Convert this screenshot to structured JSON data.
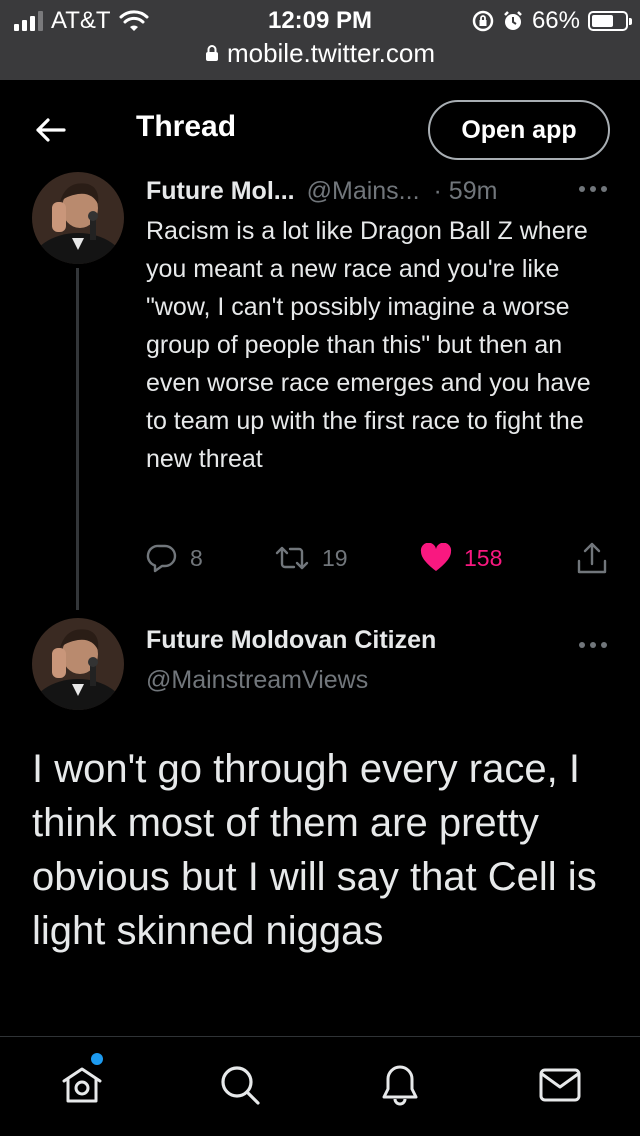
{
  "status_bar": {
    "carrier": "AT&T",
    "time": "12:09 PM",
    "battery_percent": "66%",
    "battery_level": 0.66,
    "signal_bars_on": 3,
    "url": "mobile.twitter.com",
    "bg_color": "#3a3a3c"
  },
  "header": {
    "title": "Thread",
    "open_app_label": "Open app",
    "back_icon": "back-arrow-icon"
  },
  "tweets": [
    {
      "display_name": "Future Mol...",
      "handle": "@Mains...",
      "time": "· 59m",
      "text": "Racism is a lot like Dragon Ball Z where you meant a new race and you're like \"wow, I can't possibly imagine a worse group of people than this\" but then an even worse race emerges and you have to team up with the first race to fight the new threat",
      "replies": "8",
      "retweets": "19",
      "likes": "158",
      "liked": true
    },
    {
      "display_name": "Future Moldovan Citizen",
      "handle": "@MainstreamViews",
      "text": "I won't go through every race, I think most of them are pretty obvious but I will say that Cell is light skinned niggas"
    }
  ],
  "nav": {
    "items": [
      "home-icon",
      "search-icon",
      "notifications-icon",
      "messages-icon"
    ],
    "home_has_new": true
  },
  "colors": {
    "background": "#000000",
    "text": "#e7e9ea",
    "muted": "#71767b",
    "like": "#f91880",
    "accent": "#1d9bf0"
  }
}
